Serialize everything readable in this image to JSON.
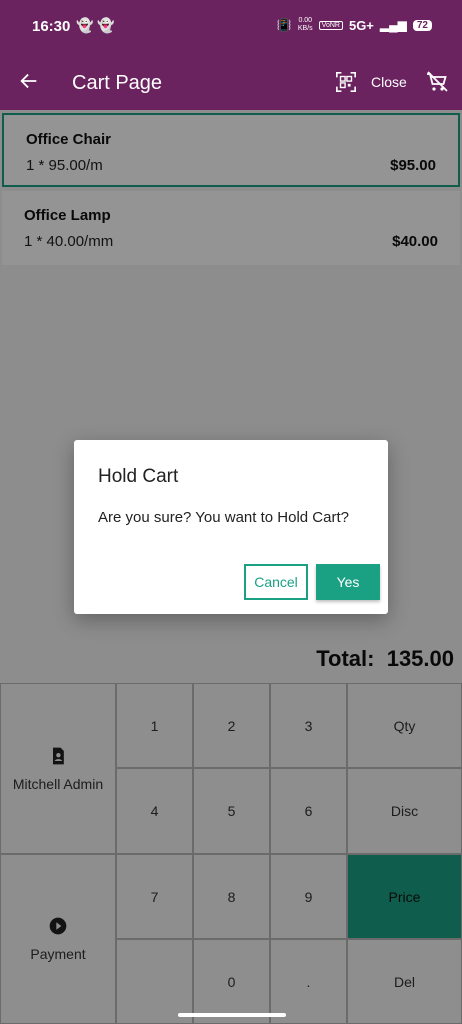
{
  "status_bar": {
    "time": "16:30",
    "net_speed_value": "0.00",
    "net_speed_unit": "KB/s",
    "volte": "VoNR",
    "network": "5G+",
    "battery": "72"
  },
  "appbar": {
    "title": "Cart Page",
    "close_label": "Close",
    "back_icon": "arrow-left-icon",
    "scan_icon": "qr-scan-icon",
    "cart_clear_icon": "cart-remove-icon",
    "color": "#6b2360"
  },
  "cart": {
    "items": [
      {
        "name": "Office Chair",
        "detail": "1 * 95.00/m",
        "price": "$95.00"
      },
      {
        "name": "Office Lamp",
        "detail": "1 * 40.00/mm",
        "price": "$40.00"
      }
    ],
    "selected_index": 0
  },
  "total": {
    "label": "Total:",
    "value": "135.00"
  },
  "keypad": {
    "customer_label": "Mitchell Admin",
    "payment_label": "Payment",
    "digits": [
      "1",
      "2",
      "3",
      "4",
      "5",
      "6",
      "7",
      "8",
      "9",
      "0",
      "."
    ],
    "modes": [
      "Qty",
      "Disc",
      "Price"
    ],
    "active_mode": "Price",
    "delete_label": "Del",
    "accent": "#1aa184"
  },
  "dialog": {
    "title": "Hold Cart",
    "message": "Are you sure? You want to Hold Cart?",
    "cancel_label": "Cancel",
    "confirm_label": "Yes"
  }
}
